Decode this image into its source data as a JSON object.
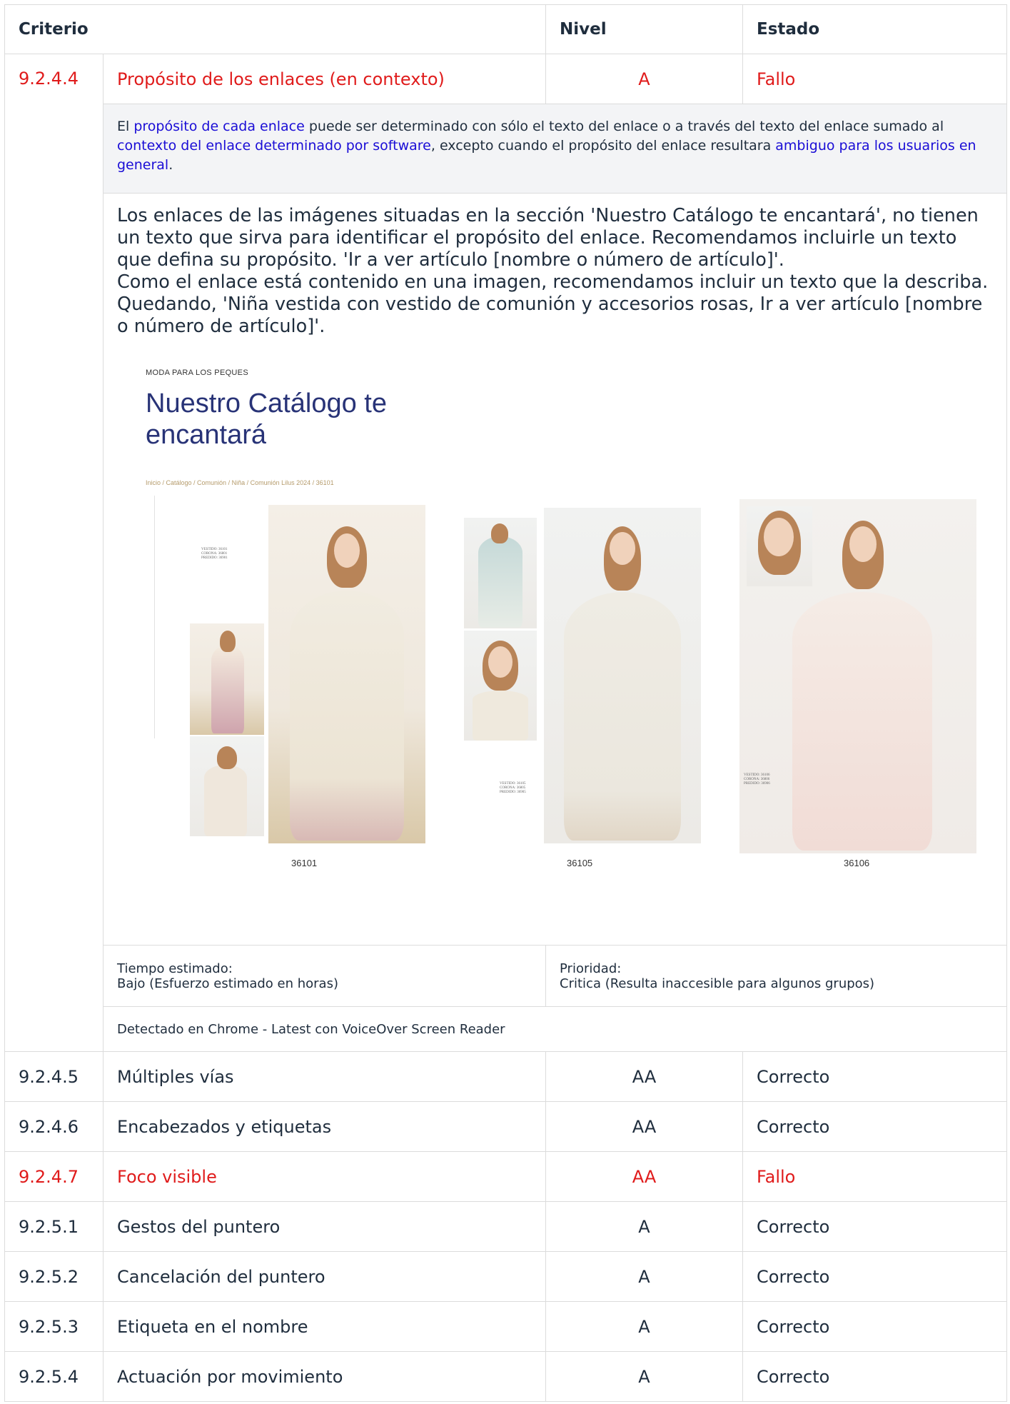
{
  "table": {
    "headers": {
      "criterio": "Criterio",
      "nivel": "Nivel",
      "estado": "Estado"
    },
    "expanded": {
      "id": "9.2.4.4",
      "name": "Propósito de los enlaces (en contexto)",
      "level": "A",
      "status": "Fallo",
      "description": {
        "t1": "El ",
        "l1": "propósito de cada enlace",
        "t2": " puede ser determinado con sólo el texto del enlace o a través del texto del enlace sumado al ",
        "l2": "contexto del enlace determinado por software",
        "t3": ", excepto cuando el propósito del enlace resultara ",
        "l3": "ambiguo para los usuarios en general",
        "t4": "."
      },
      "observation": {
        "p1": "Los enlaces de las imágenes situadas en la sección 'Nuestro Catálogo te encantará', no tienen un texto que sirva para identificar el propósito del enlace. Recomendamos incluirle un texto que defina su propósito. 'Ir a ver artículo [nombre o número de artículo]'.",
        "p2": "Como el enlace está contenido en una imagen, recomendamos incluir un texto que la describa. Quedando, 'Niña vestida con vestido de comunión y accesorios rosas, Ir a ver artículo [nombre o número de artículo]'."
      },
      "screenshot": {
        "kicker": "MODA PARA LOS PEQUES",
        "title": "Nuestro Catálogo te encantará",
        "breadcrumb": "Inicio / Catálogo / Comunión / Niña / Comunión Lilus 2024 / 36101",
        "products": [
          {
            "code": "36101",
            "tag": "VESTIDO: 36101 CORONA: 36801 PREDIDO: 36901"
          },
          {
            "code": "36105",
            "tag": "VESTIDO: 36105 CORONA: 36805 PREDIDO: 36905"
          },
          {
            "code": "36106",
            "tag": "VESTIDO: 36106 CORONA: 36806 PREDIDO: 36906"
          }
        ]
      },
      "time_label": "Tiempo estimado:",
      "time_value": "Bajo (Esfuerzo estimado en horas)",
      "priority_label": "Prioridad:",
      "priority_value": "Critica (Resulta inaccesible para algunos grupos)",
      "detected": "Detectado en Chrome - Latest con VoiceOver Screen Reader"
    },
    "rows": [
      {
        "id": "9.2.4.5",
        "name": "Múltiples vías",
        "level": "AA",
        "status": "Correcto"
      },
      {
        "id": "9.2.4.6",
        "name": "Encabezados y etiquetas",
        "level": "AA",
        "status": "Correcto"
      },
      {
        "id": "9.2.4.7",
        "name": "Foco visible",
        "level": "AA",
        "status": "Fallo"
      },
      {
        "id": "9.2.5.1",
        "name": "Gestos del puntero",
        "level": "A",
        "status": "Correcto"
      },
      {
        "id": "9.2.5.2",
        "name": "Cancelación del puntero",
        "level": "A",
        "status": "Correcto"
      },
      {
        "id": "9.2.5.3",
        "name": "Etiqueta en el nombre",
        "level": "A",
        "status": "Correcto"
      },
      {
        "id": "9.2.5.4",
        "name": "Actuación por movimiento",
        "level": "A",
        "status": "Correcto"
      }
    ]
  },
  "colors": {
    "fail": "#e01b1b",
    "link": "#1a0dd6",
    "text": "#1f2d3d",
    "desc_bg": "#f3f4f6",
    "title_blue": "#283377"
  }
}
